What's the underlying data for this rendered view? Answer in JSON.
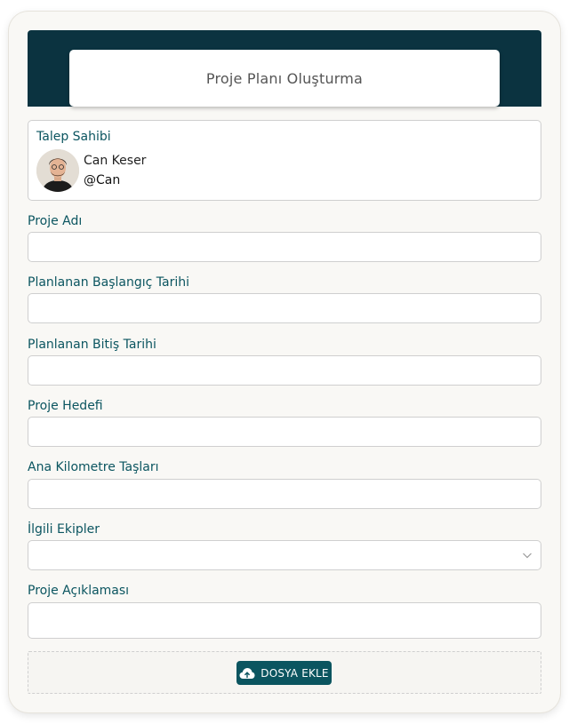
{
  "header": {
    "title": "Proje Planı Oluşturma"
  },
  "requester": {
    "label": "Talep Sahibi",
    "name": "Can Keser",
    "handle": "@Can"
  },
  "fields": [
    {
      "label": "Proje Adı",
      "value": "",
      "type": "text"
    },
    {
      "label": "Planlanan Başlangıç Tarihi",
      "value": "",
      "type": "text"
    },
    {
      "label": "Planlanan Bitiş Tarihi",
      "value": "",
      "type": "text"
    },
    {
      "label": "Proje Hedefi",
      "value": "",
      "type": "text"
    },
    {
      "label": "Ana Kilometre Taşları",
      "value": "",
      "type": "text"
    },
    {
      "label": "İlgili Ekipler",
      "value": "",
      "type": "select"
    },
    {
      "label": "Proje Açıklaması",
      "value": "",
      "type": "textarea"
    }
  ],
  "upload": {
    "button_label": "DOSYA EKLE",
    "icon": "cloud-upload-icon"
  },
  "colors": {
    "banner": "#0b3340",
    "accent": "#0b5560"
  }
}
